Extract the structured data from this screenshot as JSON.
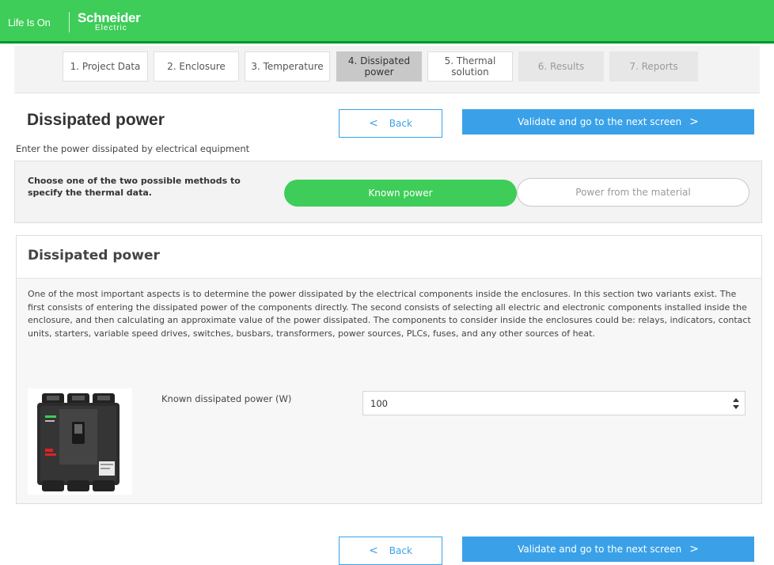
{
  "header": {
    "tagline": "Life Is On",
    "brand": "Schneider",
    "brand_sub": "Electric",
    "color_primary": "#3dcd58",
    "color_accent": "#3aa1e8"
  },
  "steps": [
    {
      "label": "1. Project Data",
      "state": "normal"
    },
    {
      "label": "2. Enclosure",
      "state": "normal"
    },
    {
      "label": "3. Temperature",
      "state": "normal"
    },
    {
      "label": "4. Dissipated power",
      "state": "active"
    },
    {
      "label": "5. Thermal solution",
      "state": "normal"
    },
    {
      "label": "6. Results",
      "state": "disabled"
    },
    {
      "label": "7. Reports",
      "state": "disabled"
    }
  ],
  "page": {
    "title": "Dissipated power",
    "subtitle": "Enter the power dissipated by electrical equipment",
    "back_label": "Back",
    "next_label": "Validate and go to the next screen"
  },
  "method": {
    "prompt": "Choose one of the two possible methods to specify the thermal data.",
    "option_known": "Known power",
    "option_material": "Power from the material",
    "selected": "Known power"
  },
  "section": {
    "title": "Dissipated power",
    "description": "One of the most important aspects is to determine the power dissipated by the electrical components inside the enclosures. In this section two variants exist. The first consists of entering the dissipated power of the components directly. The second consists of selecting all electric and electronic components installed inside the enclosure, and then calculating an approximate value of the power dissipated. The components to consider inside the enclosures could be: relays, indicators, contact units, starters, variable speed drives, switches, busbars, transformers, power sources, PLCs, fuses, and any other sources of heat.",
    "field_label": "Known dissipated power (W)",
    "field_value": "100"
  },
  "footer": {
    "back_label": "Back",
    "next_label": "Validate and go to the next screen"
  }
}
